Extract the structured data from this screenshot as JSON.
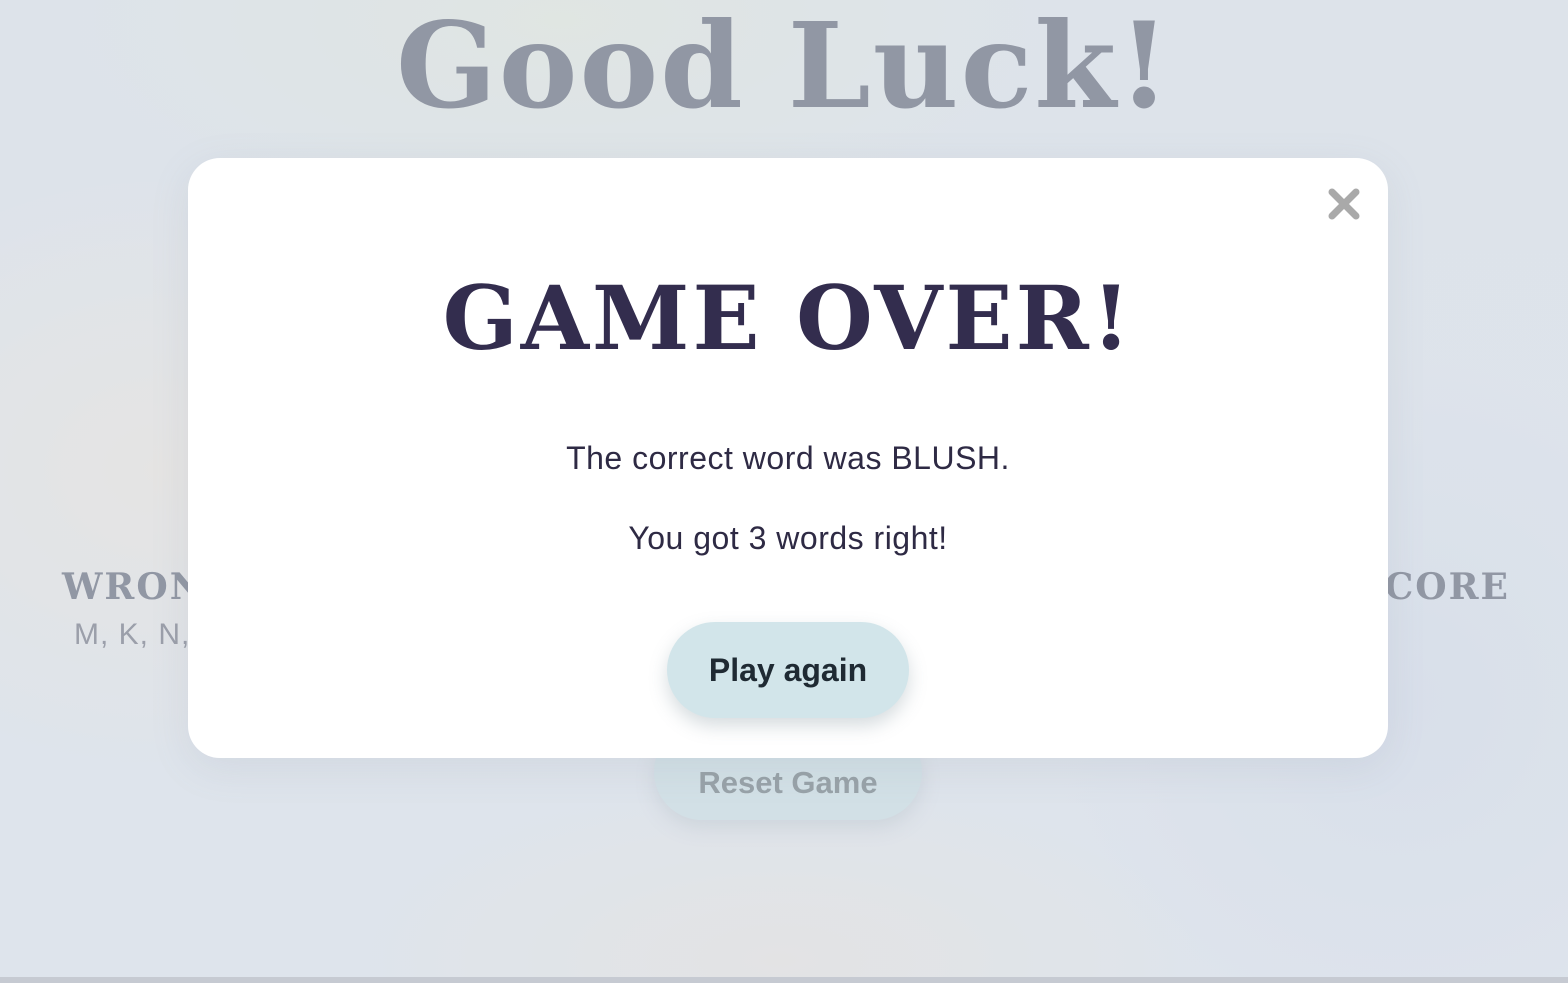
{
  "page": {
    "title": "Good Luck!",
    "wrong_label": "WRON",
    "wrong_letters": "M, K, N,",
    "score_label": "SCORE",
    "reset_label": "Reset Game"
  },
  "modal": {
    "title": "GAME OVER!",
    "correct_word_text": "The correct word was BLUSH.",
    "score_text": "You got 3 words right!",
    "play_again_label": "Play again",
    "close_icon": "close-icon"
  },
  "colors": {
    "title_color": "#727786",
    "modal_title_color": "#332d4e",
    "button_bg": "#d2e5ea"
  }
}
